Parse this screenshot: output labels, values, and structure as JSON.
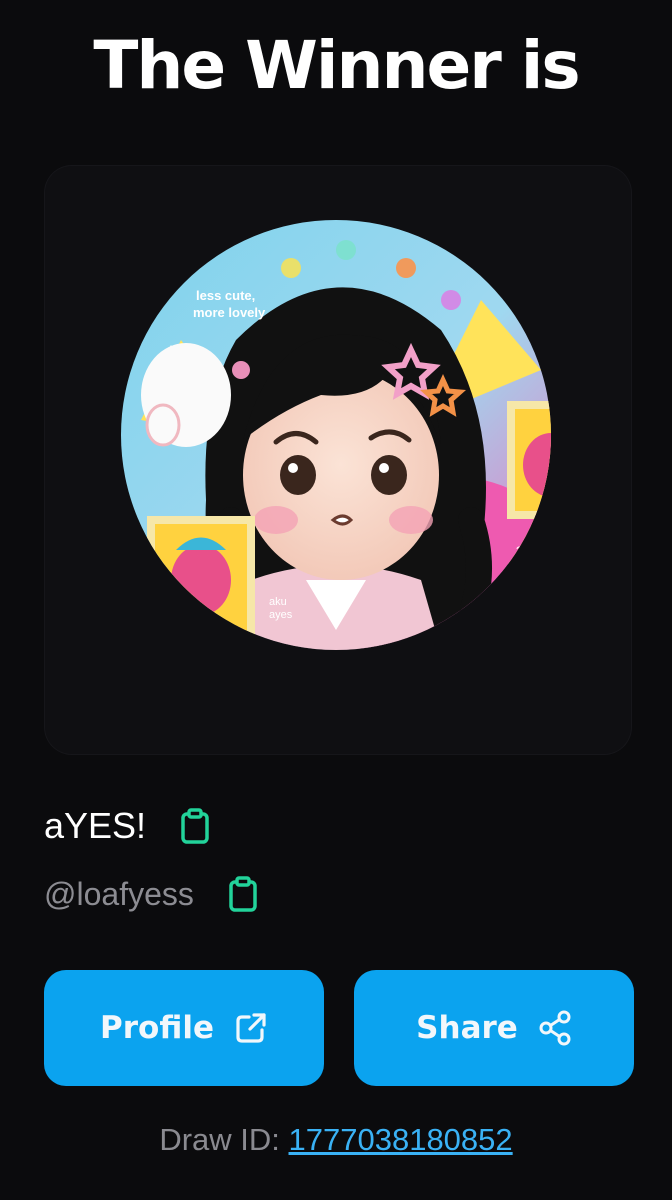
{
  "header": {
    "title": "The Winner is"
  },
  "avatar": {
    "art_text_1": "less cute,",
    "art_text_2": "more lovely",
    "art_text_3": "??!",
    "art_text_4": "aku",
    "art_text_5": "ayes"
  },
  "winner": {
    "display_name": "aYES!",
    "handle": "@loafyess"
  },
  "buttons": {
    "profile_label": "Profile",
    "share_label": "Share"
  },
  "draw": {
    "label": "Draw ID:",
    "id": "1777038180852"
  },
  "colors": {
    "background": "#0b0b0d",
    "button": "#0ba3ef",
    "copy_icon": "#22d39a",
    "link": "#3ab2f5"
  },
  "icons": {
    "copy": "clipboard-icon",
    "profile": "external-link-icon",
    "share": "share-nodes-icon"
  }
}
